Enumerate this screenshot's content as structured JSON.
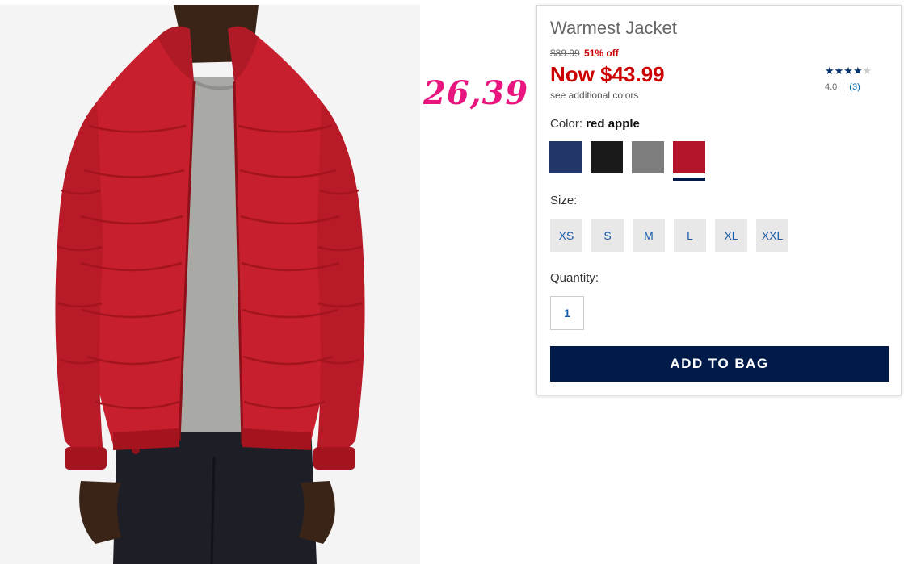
{
  "product": {
    "title": "Warmest Jacket",
    "original_price": "$89.99",
    "discount": "51% off",
    "now_price": "Now $43.99",
    "additional_colors": "see additional colors",
    "image_icon": "red-puffer-jacket-photo"
  },
  "annotation": {
    "handwritten_price": "26,39",
    "color": "#e8157f"
  },
  "rating": {
    "stars_filled": "★★★★",
    "stars_empty": "★",
    "value": "4.0",
    "count": "(3)",
    "score": 4.0,
    "max": 5
  },
  "color": {
    "label": "Color:",
    "selected": "red apple",
    "swatches": [
      {
        "name": "navy",
        "hex": "#22366a",
        "selected": false
      },
      {
        "name": "black",
        "hex": "#1a1a1a",
        "selected": false
      },
      {
        "name": "grey",
        "hex": "#7d7d7d",
        "selected": false
      },
      {
        "name": "red apple",
        "hex": "#b5142a",
        "selected": true
      }
    ]
  },
  "size": {
    "label": "Size:",
    "options": [
      "XS",
      "S",
      "M",
      "L",
      "XL",
      "XXL"
    ]
  },
  "quantity": {
    "label": "Quantity:",
    "value": "1"
  },
  "cta": {
    "add_to_bag": "ADD TO BAG"
  },
  "colors": {
    "sale_red": "#cc0000",
    "brand_navy": "#001a49",
    "link_blue": "#1a5ca8"
  }
}
